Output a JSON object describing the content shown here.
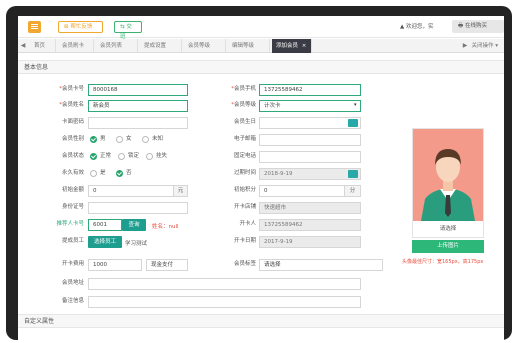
{
  "topbar": {
    "pill_orange": "⊠ 帮忙反馈",
    "pill_green": "⇆ 交班",
    "welcome": "▲ 欢迎您，实",
    "buy_button": "🖶 在线购买"
  },
  "tabs": {
    "left_arrow": "◀",
    "right_arrow": "▶",
    "items": [
      "首页",
      "会员刷卡",
      "会员列表",
      "提成设置",
      "会员等级",
      "编辑等级",
      "添加会员"
    ],
    "close_mark": "×",
    "more": "关闭操作 ▾"
  },
  "sections": {
    "basic": "基本信息",
    "custom": "自定义属性"
  },
  "form": {
    "card_no": {
      "label": "会员卡号",
      "value": "8000168"
    },
    "mobile": {
      "label": "会员手机",
      "value": "13725589462"
    },
    "name": {
      "label": "会员姓名",
      "value": "新会员"
    },
    "level": {
      "label": "会员等级",
      "value": "计次卡"
    },
    "card_pwd": {
      "label": "卡面密码",
      "value": ""
    },
    "birthday": {
      "label": "会员生日",
      "value": ""
    },
    "gender": {
      "label": "会员性别",
      "options": [
        "男",
        "女",
        "未知"
      ],
      "selected": "男"
    },
    "email": {
      "label": "电子邮箱",
      "value": ""
    },
    "status": {
      "label": "会员状态",
      "options": [
        "正常",
        "锁定",
        "挂失"
      ],
      "selected": "正常"
    },
    "phone": {
      "label": "固定电话",
      "value": ""
    },
    "permanent": {
      "label": "永久有效",
      "options": [
        "是",
        "否"
      ],
      "selected": "否"
    },
    "expire": {
      "label": "过期时间",
      "value": "2018-9-19"
    },
    "init_amount": {
      "label": "初始金额",
      "value": "0",
      "unit": "元"
    },
    "init_points": {
      "label": "初始积分",
      "value": "0",
      "unit": "分"
    },
    "id_card": {
      "label": "身份证号",
      "value": ""
    },
    "store": {
      "label": "开卡店铺",
      "value": "快速超市"
    },
    "referrer": {
      "label": "推荐人卡号",
      "value": "6001",
      "button": "查询",
      "note": "姓名：null"
    },
    "opener": {
      "label": "开卡人",
      "value": "13725589462"
    },
    "staff": {
      "label": "提成员工",
      "button": "选择员工",
      "value": "学习测试"
    },
    "open_date": {
      "label": "开卡日期",
      "value": "2017-9-19"
    },
    "fee": {
      "label": "开卡费用",
      "value": "1000",
      "pay": "现金支付"
    },
    "tags": {
      "label": "会员标签",
      "value": "请选择"
    },
    "address": {
      "label": "会员地址",
      "value": ""
    },
    "remark": {
      "label": "备注信息",
      "value": ""
    }
  },
  "avatar": {
    "select_text": "请选择",
    "upload_button": "上传图片",
    "hint": "头像最佳尺寸：宽165px，高175px"
  },
  "colors": {
    "accent_green": "#2fa97a",
    "teal": "#1e9e8e",
    "orange": "#f0a830",
    "active_tab": "#3b3b45",
    "avatar_bg": "#f39a8b"
  }
}
